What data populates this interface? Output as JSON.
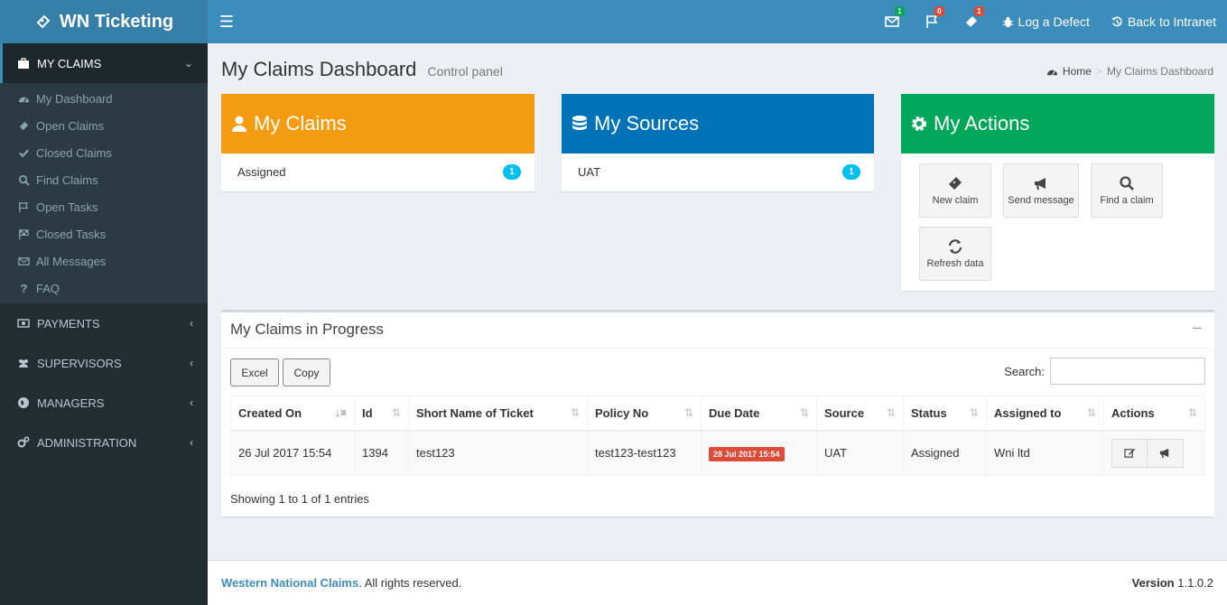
{
  "app": {
    "title": "WN Ticketing"
  },
  "navbar": {
    "badges": {
      "messages": "1",
      "flags": "0",
      "tickets": "1"
    },
    "log_defect": "Log a Defect",
    "back_intranet": "Back to Intranet"
  },
  "sidebar": {
    "my_claims": "MY CLAIMS",
    "items": [
      {
        "label": "My Dashboard",
        "icon": "dashboard-icon"
      },
      {
        "label": "Open Claims",
        "icon": "ticket-icon"
      },
      {
        "label": "Closed Claims",
        "icon": "check-icon"
      },
      {
        "label": "Find Claims",
        "icon": "search-icon"
      },
      {
        "label": "Open Tasks",
        "icon": "flag-outline-icon"
      },
      {
        "label": "Closed Tasks",
        "icon": "flag-checkered-icon"
      },
      {
        "label": "All Messages",
        "icon": "envelope-icon"
      },
      {
        "label": "FAQ",
        "icon": "question-icon"
      }
    ],
    "payments": "PAYMENTS",
    "supervisors": "SUPERVISORS",
    "managers": "MANAGERS",
    "administration": "ADMINISTRATION"
  },
  "page": {
    "title": "My Claims Dashboard",
    "subtitle": "Control panel",
    "breadcrumb_home": "Home",
    "breadcrumb_current": "My Claims Dashboard"
  },
  "cards": {
    "claims": {
      "title": "My Claims",
      "row_label": "Assigned",
      "row_count": "1",
      "color": "#f39c12"
    },
    "sources": {
      "title": "My Sources",
      "row_label": "UAT",
      "row_count": "1",
      "color": "#0073b7"
    },
    "actions": {
      "title": "My Actions",
      "color": "#00a65a",
      "new_claim": "New claim",
      "send_message": "Send message",
      "find_claim": "Find a claim",
      "refresh": "Refresh data"
    }
  },
  "progress": {
    "title": "My Claims in Progress",
    "excel": "Excel",
    "copy": "Copy",
    "search_label": "Search:",
    "columns": [
      "Created On",
      "Id",
      "Short Name of Ticket",
      "Policy No",
      "Due Date",
      "Source",
      "Status",
      "Assigned to",
      "Actions"
    ],
    "row": {
      "created": "26 Jul 2017 15:54",
      "id": "1394",
      "name": "test123",
      "policy": "test123-test123",
      "due": "28 Jul 2017 15:54",
      "source": "UAT",
      "status": "Assigned",
      "assigned": "Wni ltd"
    },
    "showing": "Showing 1 to 1 of 1 entries"
  },
  "footer": {
    "brand": "Western National Claims",
    "rights": ". All rights reserved.",
    "version_label": "Version",
    "version": "1.1.0.2"
  },
  "colors": {
    "accent": "#3c8dbc",
    "sidebar": "#222d32",
    "danger": "#dd4b39",
    "info": "#00c0ef"
  }
}
